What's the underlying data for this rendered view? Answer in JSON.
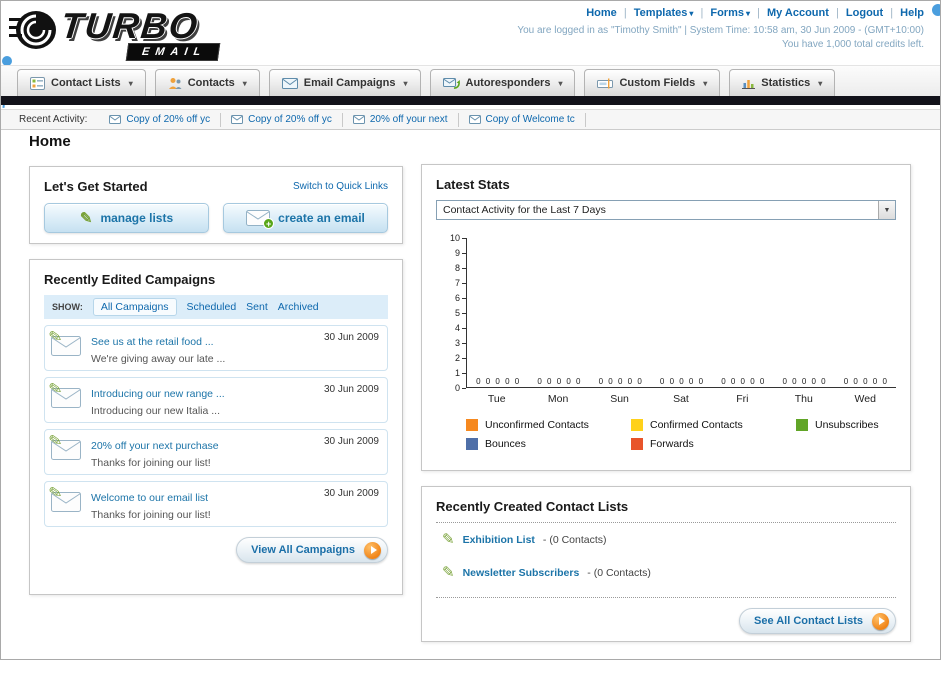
{
  "header": {
    "logo_title": "TURBO",
    "logo_subtitle": "EMAIL",
    "nav_links": [
      "Home",
      "Templates",
      "Forms",
      "My Account",
      "Logout",
      "Help"
    ],
    "login_info": "You are logged in as \"Timothy Smith\" | System Time: 10:58 am, 30 Jun 2009 - (GMT+10:00)",
    "credits_info": "You have 1,000 total credits left."
  },
  "main_nav": {
    "tabs": [
      {
        "label": "Contact Lists"
      },
      {
        "label": "Contacts"
      },
      {
        "label": "Email Campaigns"
      },
      {
        "label": "Autoresponders"
      },
      {
        "label": "Custom Fields"
      },
      {
        "label": "Statistics"
      }
    ]
  },
  "recent_activity": {
    "label": "Recent Activity:",
    "items": [
      {
        "text": "Copy of 20% off yc"
      },
      {
        "text": "Copy of 20% off yc"
      },
      {
        "text": "20% off your next"
      },
      {
        "text": "Copy of Welcome tc"
      }
    ]
  },
  "page_title": "Home",
  "get_started": {
    "title": "Let's Get Started",
    "switch_link": "Switch to Quick Links",
    "manage_lists_label": "manage lists",
    "create_email_label": "create an email"
  },
  "campaigns": {
    "title": "Recently Edited Campaigns",
    "show_label": "SHOW:",
    "filters": [
      {
        "label": "All Campaigns",
        "active": true
      },
      {
        "label": "Scheduled",
        "active": false
      },
      {
        "label": "Sent",
        "active": false
      },
      {
        "label": "Archived",
        "active": false
      }
    ],
    "items": [
      {
        "title": "See us at the retail food ...",
        "subtitle": "We're giving away our late ...",
        "date": "30 Jun 2009"
      },
      {
        "title": "Introducing our new range ...",
        "subtitle": "Introducing our new Italia ...",
        "date": "30 Jun 2009"
      },
      {
        "title": "20% off your next purchase",
        "subtitle": "Thanks for joining our list!",
        "date": "30 Jun 2009"
      },
      {
        "title": "Welcome to our email list",
        "subtitle": "Thanks for joining our list!",
        "date": "30 Jun 2009"
      }
    ],
    "view_all_label": "View All Campaigns"
  },
  "stats": {
    "title": "Latest Stats",
    "dropdown_value": "Contact Activity for the Last 7 Days",
    "chart_data": {
      "type": "bar",
      "title": "Contact Activity for the Last 7 Days",
      "categories": [
        "Tue",
        "Mon",
        "Sun",
        "Sat",
        "Fri",
        "Thu",
        "Wed"
      ],
      "series": [
        {
          "name": "Unconfirmed Contacts",
          "color": "#f6891f",
          "values": [
            0,
            0,
            0,
            0,
            0,
            0,
            0
          ]
        },
        {
          "name": "Confirmed Contacts",
          "color": "#ffd11a",
          "values": [
            0,
            0,
            0,
            0,
            0,
            0,
            0
          ]
        },
        {
          "name": "Unsubscribes",
          "color": "#61a527",
          "values": [
            0,
            0,
            0,
            0,
            0,
            0,
            0
          ]
        },
        {
          "name": "Bounces",
          "color": "#4f6fa8",
          "values": [
            0,
            0,
            0,
            0,
            0,
            0,
            0
          ]
        },
        {
          "name": "Forwards",
          "color": "#e8542a",
          "values": [
            0,
            0,
            0,
            0,
            0,
            0,
            0
          ]
        }
      ],
      "ylim": [
        0,
        10
      ],
      "yticks": [
        0,
        1,
        2,
        3,
        4,
        5,
        6,
        7,
        8,
        9,
        10
      ],
      "grid": false,
      "legend_position": "bottom"
    }
  },
  "contact_lists": {
    "title": "Recently Created Contact Lists",
    "items": [
      {
        "name": "Exhibition List",
        "detail": "- (0 Contacts)"
      },
      {
        "name": "Newsletter Subscribers",
        "detail": "- (0 Contacts)"
      }
    ],
    "see_all_label": "See All Contact Lists"
  }
}
